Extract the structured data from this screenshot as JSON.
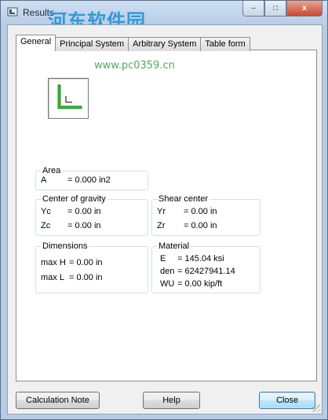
{
  "window": {
    "title": "Results"
  },
  "watermark": {
    "text": "河东软件园",
    "url": "www.pc0359.cn"
  },
  "caption": {
    "minimize": "–",
    "maximize": "□",
    "close": "x"
  },
  "tabs": [
    {
      "label": "General",
      "active": true
    },
    {
      "label": "Principal System",
      "active": false
    },
    {
      "label": "Arbitrary System",
      "active": false
    },
    {
      "label": "Table form",
      "active": false
    }
  ],
  "area": {
    "title": "Area",
    "rows": [
      {
        "label": "A",
        "value": "= 0.000 in2"
      }
    ]
  },
  "center_of_gravity": {
    "title": "Center of gravity",
    "rows": [
      {
        "label": "Yc",
        "value": "= 0.00 in"
      },
      {
        "label": "Zc",
        "value": "= 0.00 in"
      }
    ]
  },
  "shear_center": {
    "title": "Shear center",
    "rows": [
      {
        "label": "Yr",
        "value": "= 0.00 in"
      },
      {
        "label": "Zr",
        "value": "= 0.00 in"
      }
    ]
  },
  "dimensions": {
    "title": "Dimensions",
    "rows": [
      {
        "label": "max H",
        "value": "= 0.00 in"
      },
      {
        "label": "max L",
        "value": "= 0.00 in"
      }
    ]
  },
  "material": {
    "title": "Material",
    "rows": [
      {
        "label": "E",
        "value": "= 145.04 ksi"
      },
      {
        "label": "den",
        "value": "= 62427941.14"
      },
      {
        "label": "WU",
        "value": "= 0.00 kip/ft"
      }
    ]
  },
  "buttons": {
    "calc_note": "Calculation Note",
    "help": "Help",
    "close": "Close"
  },
  "colors": {
    "shape_green": "#2fbf2f",
    "accent": "#3c7fb1"
  }
}
